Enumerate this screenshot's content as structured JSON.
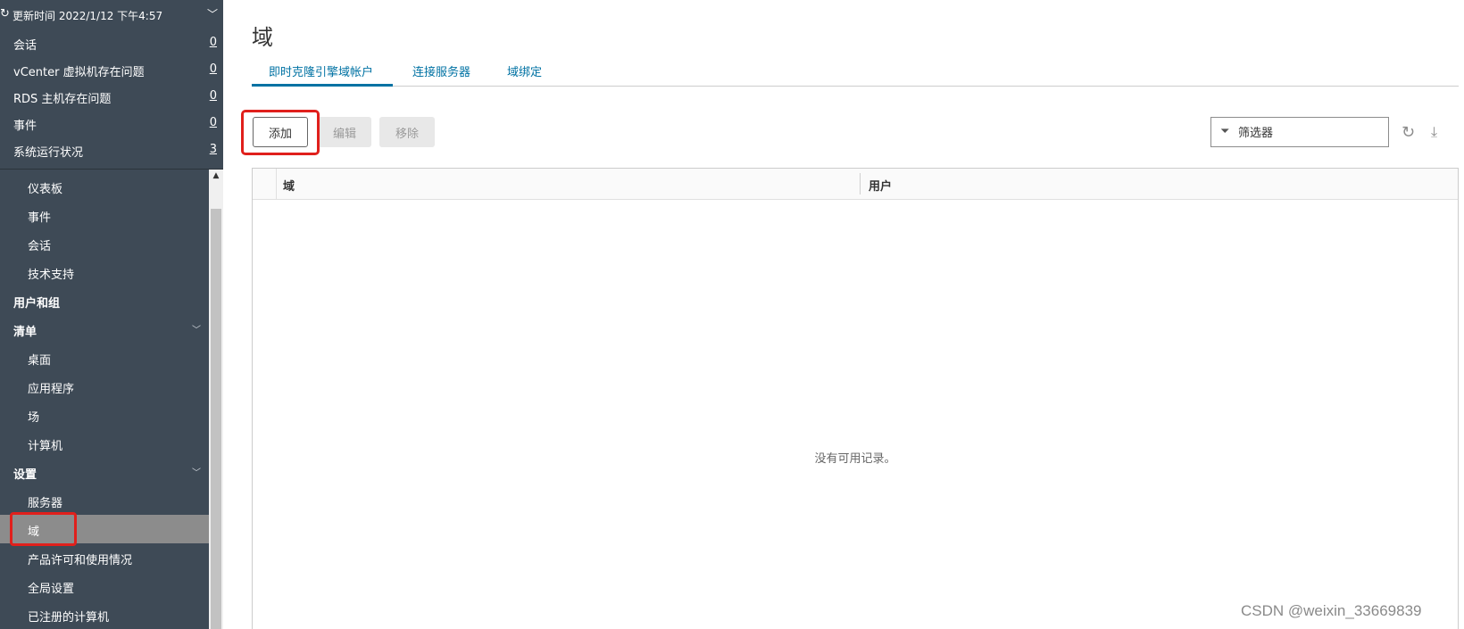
{
  "status": {
    "updated": "更新时间 2022/1/12 下午4:57",
    "rows": [
      {
        "label": "会话",
        "count": "0"
      },
      {
        "label": "vCenter 虚拟机存在问题",
        "count": "0"
      },
      {
        "label": "RDS 主机存在问题",
        "count": "0"
      },
      {
        "label": "事件",
        "count": "0"
      },
      {
        "label": "系统运行状况",
        "count": "3"
      }
    ]
  },
  "nav": {
    "items": [
      {
        "label": "仪表板"
      },
      {
        "label": "事件"
      },
      {
        "label": "会话"
      },
      {
        "label": "技术支持"
      },
      {
        "label": "用户和组"
      },
      {
        "label": "清单"
      },
      {
        "label": "桌面"
      },
      {
        "label": "应用程序"
      },
      {
        "label": "场"
      },
      {
        "label": "计算机"
      },
      {
        "label": "设置"
      },
      {
        "label": "服务器"
      },
      {
        "label": "域"
      },
      {
        "label": "产品许可和使用情况"
      },
      {
        "label": "全局设置"
      },
      {
        "label": "已注册的计算机"
      }
    ]
  },
  "main": {
    "title": "域",
    "tabs": [
      {
        "label": "即时克隆引擎域帐户"
      },
      {
        "label": "连接服务器"
      },
      {
        "label": "域绑定"
      }
    ],
    "toolbar": {
      "add": "添加",
      "edit": "编辑",
      "remove": "移除"
    },
    "filter": {
      "placeholder": "筛选器"
    },
    "grid": {
      "columns": [
        "域",
        "用户"
      ],
      "empty": "没有可用记录。"
    }
  },
  "watermark": "CSDN @weixin_33669839",
  "colors": {
    "sidebar_bg": "#3e4a56",
    "active_item": "#8c8c8c",
    "link": "#0072a3",
    "highlight": "#e0201c"
  }
}
